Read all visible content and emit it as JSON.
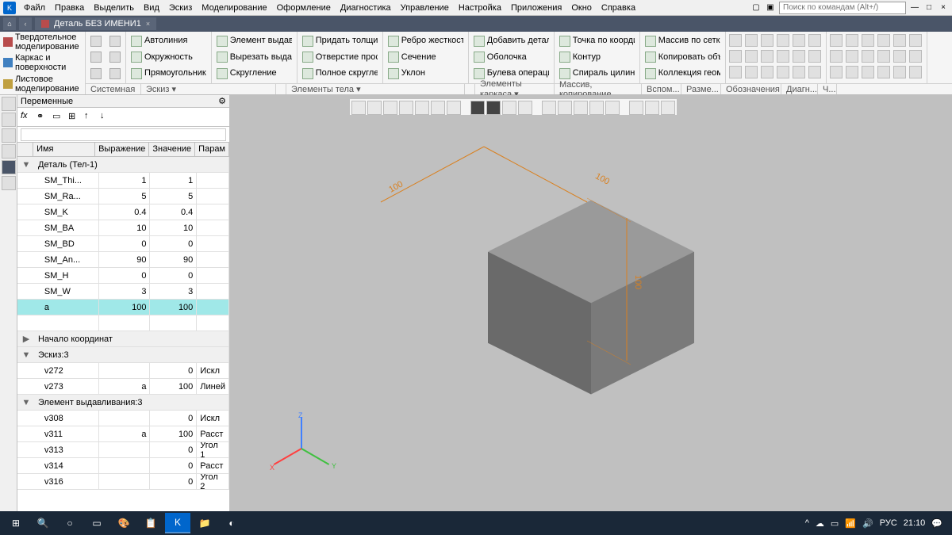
{
  "menu": [
    "Файл",
    "Правка",
    "Выделить",
    "Вид",
    "Эскиз",
    "Моделирование",
    "Оформление",
    "Диагностика",
    "Управление",
    "Настройка",
    "Приложения",
    "Окно",
    "Справка"
  ],
  "search_placeholder": "Поиск по командам (Alt+/)",
  "tab": {
    "title": "Деталь БЕЗ ИМЕНИ1"
  },
  "rib_cats": [
    {
      "label": "Твердотельное моделирование"
    },
    {
      "label": "Каркас и поверхности"
    },
    {
      "label": "Листовое моделирование"
    }
  ],
  "rib_groups": [
    {
      "tools": [
        "",
        "",
        "",
        "",
        "",
        ""
      ],
      "label": "Системная"
    },
    {
      "tools": [
        {
          "l": "Автолиния"
        },
        {
          "l": "Окружность"
        },
        {
          "l": "Прямоугольник"
        }
      ],
      "label": "Эскиз"
    },
    {
      "tools": [
        {
          "l": "Элемент выдавливания"
        },
        {
          "l": "Вырезать выдавливанием"
        },
        {
          "l": "Скругление"
        }
      ]
    },
    {
      "tools": [
        {
          "l": "Придать толщину"
        },
        {
          "l": "Отверстие простое"
        },
        {
          "l": "Полное скругление"
        }
      ]
    },
    {
      "tools": [
        {
          "l": "Ребро жесткости"
        },
        {
          "l": "Сечение"
        },
        {
          "l": "Уклон"
        }
      ],
      "label": "Элементы тела"
    },
    {
      "tools": [
        {
          "l": "Добавить деталь-загот..."
        },
        {
          "l": "Оболочка"
        },
        {
          "l": "Булева операция"
        }
      ]
    },
    {
      "tools": [
        {
          "l": "Точка по координатам"
        },
        {
          "l": "Контур"
        },
        {
          "l": "Спираль цилиндрическ..."
        }
      ],
      "label": "Элементы каркаса"
    },
    {
      "tools": [
        {
          "l": "Массив по сетке"
        },
        {
          "l": "Копировать объекты"
        },
        {
          "l": "Коллекция геометрии"
        }
      ],
      "label": "Массив, копирование"
    }
  ],
  "rib_label_extra": [
    "Вспом...",
    "Разме...",
    "Обозначения",
    "Диагн...",
    "Ч..."
  ],
  "panel": {
    "title": "Переменные",
    "cols": [
      "Имя",
      "Выражение",
      "Значение",
      "Парам"
    ],
    "groups": [
      {
        "name": "Деталь (Тел-1)",
        "exp": true,
        "rows": [
          {
            "n": "SM_Thi...",
            "e": "1",
            "v": "1"
          },
          {
            "n": "SM_Ra...",
            "e": "5",
            "v": "5"
          },
          {
            "n": "SM_K",
            "e": "0.4",
            "v": "0.4"
          },
          {
            "n": "SM_BA",
            "e": "10",
            "v": "10"
          },
          {
            "n": "SM_BD",
            "e": "0",
            "v": "0"
          },
          {
            "n": "SM_An...",
            "e": "90",
            "v": "90"
          },
          {
            "n": "SM_H",
            "e": "0",
            "v": "0"
          },
          {
            "n": "SM_W",
            "e": "3",
            "v": "3"
          },
          {
            "n": "a",
            "e": "100",
            "v": "100",
            "sel": true
          }
        ]
      },
      {
        "name": "Начало координат",
        "exp": false,
        "rows": []
      },
      {
        "name": "Эскиз:3",
        "exp": true,
        "rows": [
          {
            "n": "v272",
            "e": "",
            "v": "0",
            "p": "Искл"
          },
          {
            "n": "v273",
            "e": "a",
            "v": "100",
            "p": "Линей"
          }
        ]
      },
      {
        "name": "Элемент выдавливания:3",
        "exp": true,
        "rows": [
          {
            "n": "v308",
            "e": "",
            "v": "0",
            "p": "Искл"
          },
          {
            "n": "v311",
            "e": "a",
            "v": "100",
            "p": "Расст"
          },
          {
            "n": "v313",
            "e": "",
            "v": "0",
            "p": "Угол 1"
          },
          {
            "n": "v314",
            "e": "",
            "v": "0",
            "p": "Расст"
          },
          {
            "n": "v316",
            "e": "",
            "v": "0",
            "p": "Угол 2"
          }
        ]
      }
    ]
  },
  "dims": {
    "a": "100",
    "b": "100",
    "c": "100"
  },
  "axis": {
    "x": "X",
    "y": "Y",
    "z": "Z"
  },
  "tray": {
    "lang": "РУС",
    "time": "21:10"
  }
}
